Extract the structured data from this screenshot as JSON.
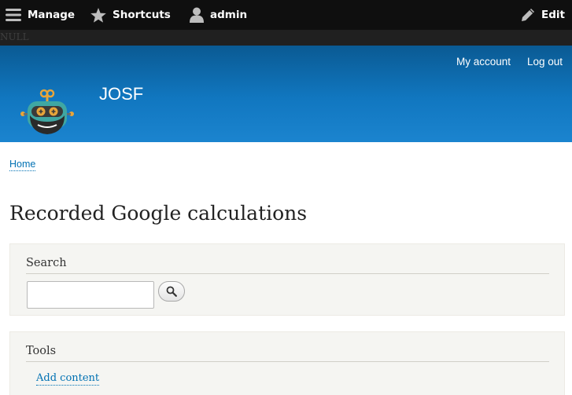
{
  "toolbar": {
    "manage": "Manage",
    "shortcuts": "Shortcuts",
    "user": "admin",
    "edit": "Edit"
  },
  "debug_text": "NULL",
  "header": {
    "site_name": "JOSF",
    "menu": [
      "My account",
      "Log out"
    ],
    "colors": {
      "gradient_top": "#0a5a93",
      "gradient_bottom": "#1b84cf"
    }
  },
  "breadcrumb": {
    "home": "Home"
  },
  "page": {
    "title": "Recorded Google calculations"
  },
  "search_block": {
    "title": "Search",
    "input_value": "",
    "button_icon": "search-icon"
  },
  "tools_block": {
    "title": "Tools",
    "links": [
      "Add content"
    ]
  },
  "icons": {
    "manage": "hamburger-icon",
    "shortcuts": "star-icon",
    "user": "user-icon",
    "edit": "pencil-icon"
  },
  "colors": {
    "link": "#0071b3",
    "toolbar_bg": "#0f0f0f",
    "block_bg": "#f5f5f2"
  }
}
